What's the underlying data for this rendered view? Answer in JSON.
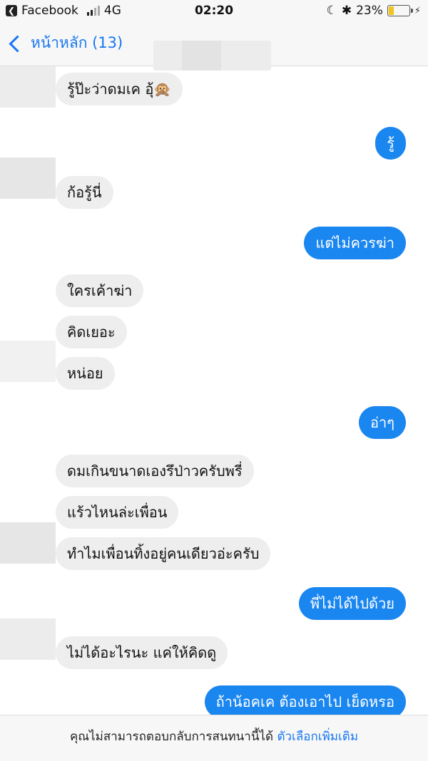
{
  "status_bar": {
    "app": "Facebook",
    "network": "4G",
    "time": "02:20",
    "battery": "23%",
    "battery_level": 0.23
  },
  "nav": {
    "back_label": "หน้าหลัก (13)"
  },
  "messages": [
    {
      "side": "in",
      "text": "รู้ป๊ะว่าดมเค อุ้🙊"
    },
    {
      "side": "out",
      "text": "รู้"
    },
    {
      "side": "in",
      "text": "ก้อรู้นี่"
    },
    {
      "side": "out",
      "text": "แต่ไม่ควรฆ่า"
    },
    {
      "side": "in",
      "text": "ใครเค้าฆ่า"
    },
    {
      "side": "in",
      "text": "คิดเยอะ"
    },
    {
      "side": "in",
      "text": "หน่อย"
    },
    {
      "side": "out",
      "text": "อ่าๆ"
    },
    {
      "side": "in",
      "text": "ดมเกินขนาดเองรึป่าวครับพรี่"
    },
    {
      "side": "in",
      "text": "แร้วไหนล่ะเพื่อน"
    },
    {
      "side": "in",
      "text": "ทำไมเพื่อนทิ้งอยู่คนเดียวอ่ะครับ"
    },
    {
      "side": "out",
      "text": "พี่ไม่ได้ไปด้วย"
    },
    {
      "side": "in",
      "text": "ไม่ได้อะไรนะ แค่ให้คิดดู"
    },
    {
      "side": "out",
      "text": "ถ้าน้อคเค ต้องเอาไป เย็ดหรอ"
    }
  ],
  "footer": {
    "notice": "คุณไม่สามารถตอบกลับการสนทนานี้ได้",
    "link": "ตัวเลือกเพิ่มเติม"
  },
  "colors": {
    "outgoing_bubble": "#1a86f0",
    "incoming_bubble": "#eeeeee",
    "link": "#1877f2"
  }
}
